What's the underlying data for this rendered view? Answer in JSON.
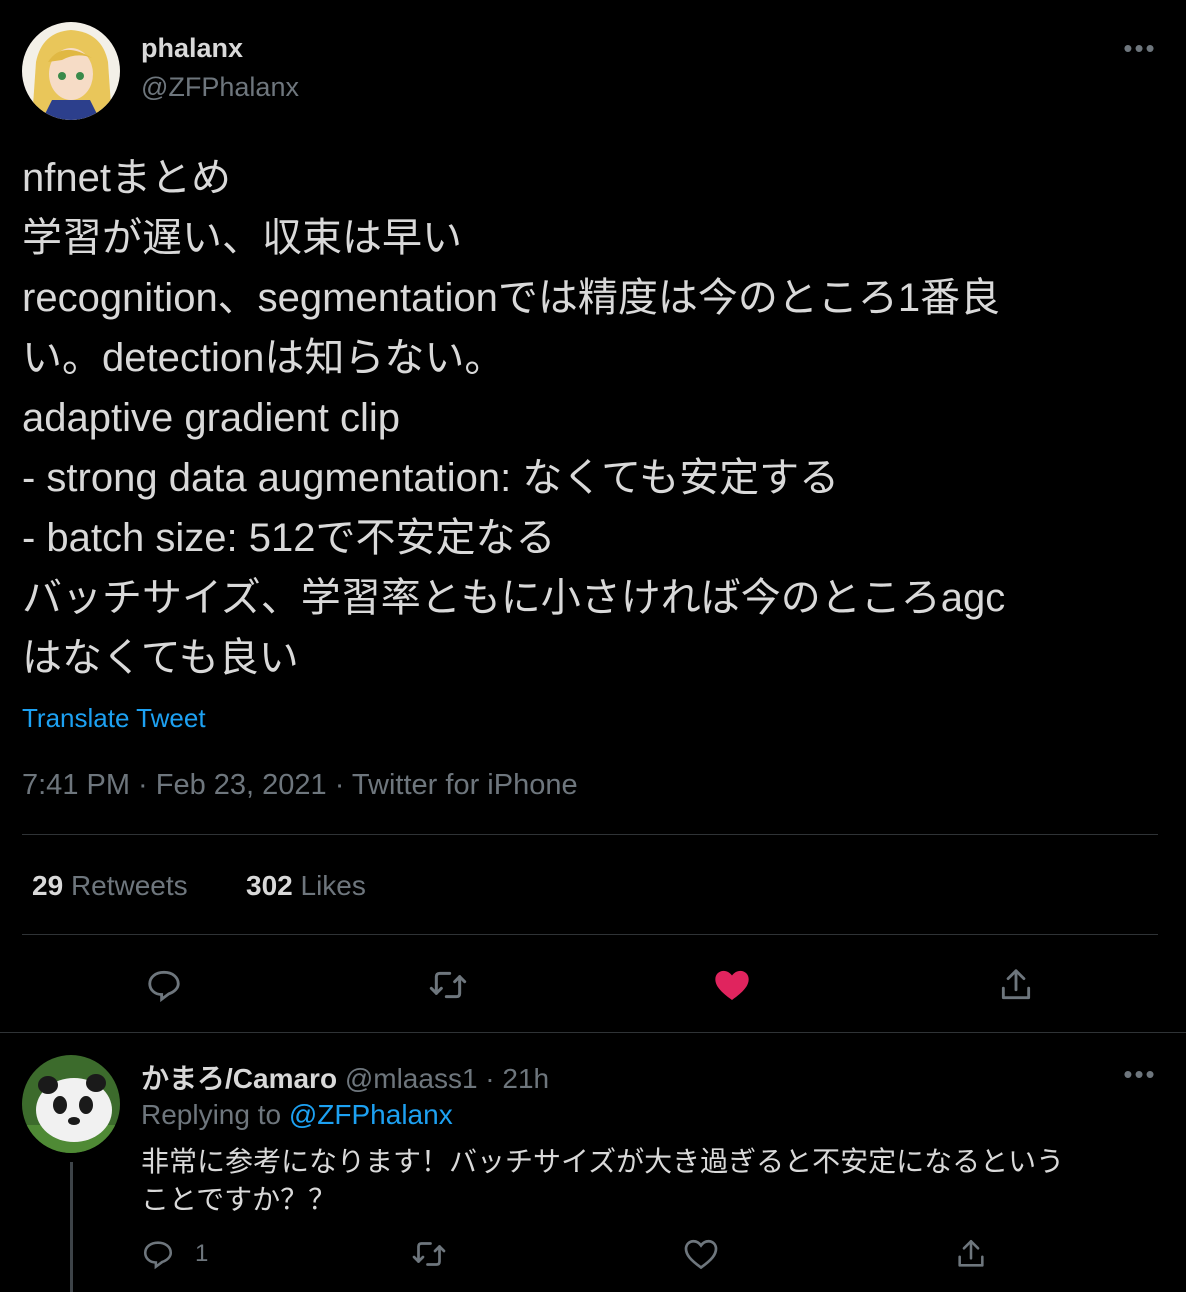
{
  "tweet": {
    "author_name": "phalanx",
    "author_handle": "@ZFPhalanx",
    "lines": [
      "nfnetまとめ",
      "学習が遅い、収束は早い",
      "recognition、segmentationでは精度は今のところ1番良",
      "い。detectionは知らない。",
      "adaptive gradient clip",
      "- strong data augmentation: なくても安定する",
      "- batch size: 512で不安定なる",
      "バッチサイズ、学習率ともに小さければ今のところagc",
      "はなくても良い"
    ],
    "translate_label": "Translate Tweet",
    "meta": "7:41 PM · Feb 23, 2021 · Twitter for iPhone",
    "retweets_count": "29",
    "retweets_label": "Retweets",
    "likes_count": "302",
    "likes_label": "Likes",
    "liked_color": "#e0245e"
  },
  "reply": {
    "author_name": "かまろ/Camaro",
    "author_handle": "@mlaass1",
    "age": "· 21h",
    "replying_prefix": "Replying to",
    "replying_handle": "@ZFPhalanx",
    "lines": [
      "非常に参考になります！バッチサイズが大き過ぎると不安定になるという",
      "ことですか？？"
    ],
    "reply_count": "1"
  },
  "icons": {
    "more": "more-icon",
    "reply": "reply-icon",
    "retweet": "retweet-icon",
    "like": "like-icon",
    "share": "share-icon"
  }
}
